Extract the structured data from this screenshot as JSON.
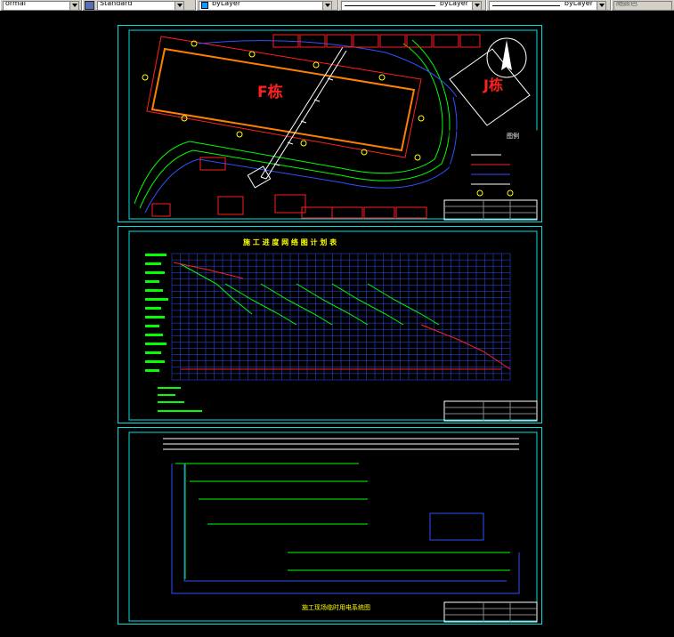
{
  "toolbar": {
    "text_style": "ormal",
    "dim_style": "Standard",
    "layer_color": "byLayer",
    "linetype": "byLayer",
    "lineweight": "byLayer",
    "plot_color": "随颜色"
  },
  "sheet1": {
    "building_f_label": "F栋",
    "building_j_label": "J栋"
  },
  "sheet2": {
    "title": "施 工 进 度 网 络 图 计 划 表"
  },
  "sheet3": {
    "title": "施工现场临时用电系统图"
  },
  "colors": {
    "frame": "#00e0e0",
    "red": "#ff2020",
    "green": "#00ff00",
    "blue": "#3050ff",
    "orange": "#ff8000",
    "yellow": "#ffff00",
    "white": "#ffffff"
  }
}
